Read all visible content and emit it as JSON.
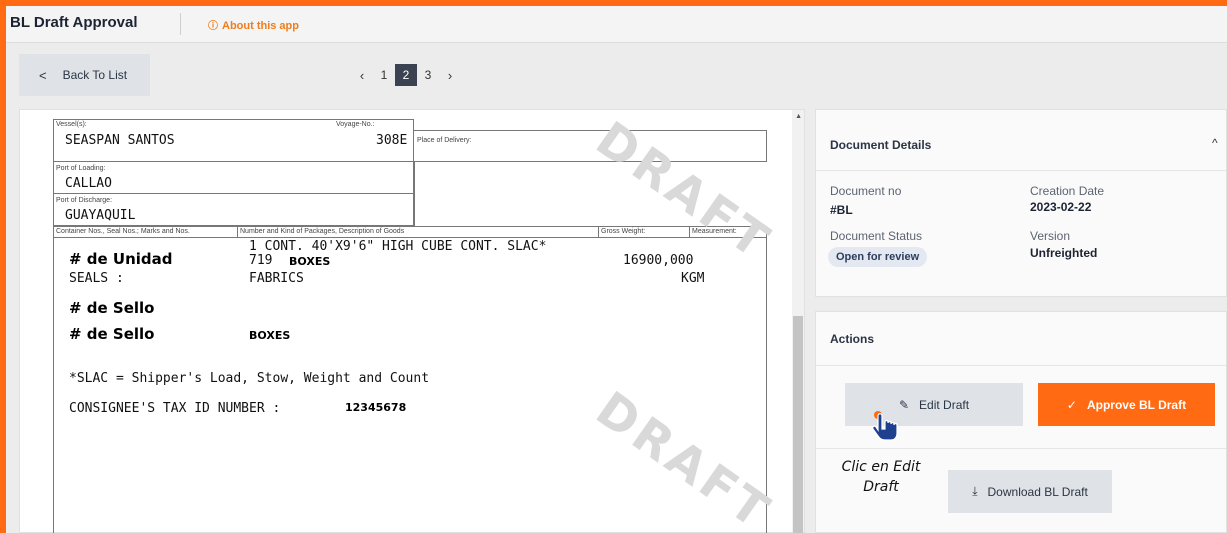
{
  "header": {
    "app_title": "BL Draft Approval",
    "about_label": "About this app",
    "about_icon": "info-icon"
  },
  "toolbar": {
    "back_label": "Back To List",
    "pages": [
      "1",
      "2",
      "3"
    ],
    "current_page": "2"
  },
  "document": {
    "vessel_label": "Vessel(s):",
    "vessel_value": "SEASPAN SANTOS",
    "voyage_label": "Voyage-No.:",
    "voyage_value": "308E",
    "place_delivery_label": "Place of Delivery:",
    "port_loading_label": "Port of Loading:",
    "port_loading_value": "CALLAO",
    "port_discharge_label": "Port of Discharge:",
    "port_discharge_value": "GUAYAQUIL",
    "col_container_label": "Container Nos., Seal Nos.; Marks and Nos.",
    "col_packages_label": "Number and Kind of Packages, Description of Goods",
    "col_gross_label": "Gross Weight:",
    "col_measurement_label": "Measurement:",
    "line_container": "1 CONT. 40'X9'6\" HIGH CUBE CONT. SLAC*",
    "line_qty": "719",
    "line_boxes": "BOXES",
    "gross_weight": "16900,000",
    "seals": "SEALS :",
    "fabrics": "FABRICS",
    "unit_kgm": "KGM",
    "note_unidad": "# de Unidad",
    "note_sello_1": "# de Sello",
    "note_sello_2": "# de Sello",
    "boxes_2": "BOXES",
    "slac_line": "*SLAC = Shipper's Load, Stow, Weight and Count",
    "tax_label": "CONSIGNEE'S TAX ID NUMBER :",
    "tax_value": "12345678",
    "watermark": "DRAFT"
  },
  "details": {
    "title": "Document Details",
    "doc_no_label": "Document no",
    "doc_no_value": "#BL",
    "creation_label": "Creation Date",
    "creation_value": "2023-02-22",
    "status_label": "Document Status",
    "status_value": "Open for review",
    "version_label": "Version",
    "version_value": "Unfreighted"
  },
  "actions": {
    "title": "Actions",
    "edit_label": "Edit Draft",
    "approve_label": "Approve BL Draft",
    "download_label": "Download BL Draft",
    "hint_line1": "Clic en Edit",
    "hint_line2": "Draft"
  },
  "colors": {
    "accent": "#ff6a13",
    "cursor": "#1f3f8f"
  }
}
